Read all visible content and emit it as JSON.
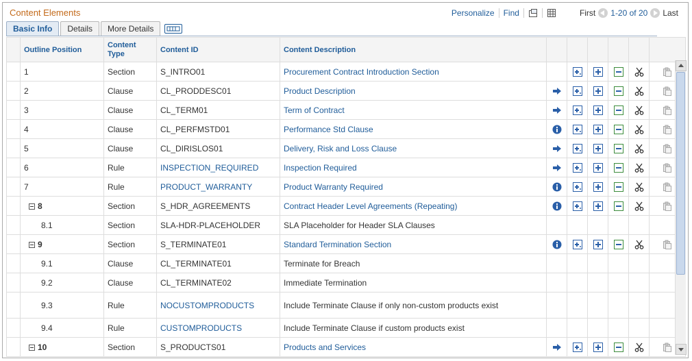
{
  "grid": {
    "title": "Content Elements",
    "personalize": "Personalize",
    "find": "Find",
    "first": "First",
    "range": "1-20 of 20",
    "last": "Last"
  },
  "tabs": [
    {
      "label": "Basic Info"
    },
    {
      "label": "Details"
    },
    {
      "label": "More Details"
    }
  ],
  "columns": {
    "outline": "Outline Position",
    "type": "Content Type",
    "id": "Content ID",
    "desc": "Content Description"
  },
  "rows": [
    {
      "pos": "1",
      "type": "Section",
      "id": "S_INTRO01",
      "desc": "Procurement Contract Introduction Section"
    },
    {
      "pos": "2",
      "type": "Clause",
      "id": "CL_PRODDESC01",
      "desc": "Product Description"
    },
    {
      "pos": "3",
      "type": "Clause",
      "id": "CL_TERM01",
      "desc": "Term of Contract"
    },
    {
      "pos": "4",
      "type": "Clause",
      "id": "CL_PERFMSTD01",
      "desc": "Performance Std Clause"
    },
    {
      "pos": "5",
      "type": "Clause",
      "id": "CL_DIRISLOS01",
      "desc": "Delivery, Risk and Loss Clause"
    },
    {
      "pos": "6",
      "type": "Rule",
      "id": "INSPECTION_REQUIRED",
      "desc": "Inspection Required"
    },
    {
      "pos": "7",
      "type": "Rule",
      "id": "PRODUCT_WARRANTY",
      "desc": "Product Warranty Required"
    },
    {
      "pos": "8",
      "type": "Section",
      "id": "S_HDR_AGREEMENTS",
      "desc": "Contract Header Level Agreements (Repeating)"
    },
    {
      "pos": "8.1",
      "type": "Section",
      "id": "SLA-HDR-PLACEHOLDER",
      "desc": "SLA Placeholder for Header SLA Clauses"
    },
    {
      "pos": "9",
      "type": "Section",
      "id": "S_TERMINATE01",
      "desc": "Standard Termination Section"
    },
    {
      "pos": "9.1",
      "type": "Clause",
      "id": "CL_TERMINATE01",
      "desc": "Terminate for Breach"
    },
    {
      "pos": "9.2",
      "type": "Clause",
      "id": "CL_TERMINATE02",
      "desc": "Immediate Termination"
    },
    {
      "pos": "9.3",
      "type": "Rule",
      "id": "NOCUSTOMPRODUCTS",
      "desc": "Include Terminate Clause if only non-custom products exist"
    },
    {
      "pos": "9.4",
      "type": "Rule",
      "id": "CUSTOMPRODUCTS",
      "desc": "Include Terminate Clause if custom products exist"
    },
    {
      "pos": "10",
      "type": "Section",
      "id": "S_PRODUCTS01",
      "desc": "Products and Services"
    }
  ],
  "colors": {
    "link": "#1f5c99",
    "title": "#c36a1a",
    "icon_blue": "#2a5fa8",
    "icon_green": "#3c8c3c"
  }
}
